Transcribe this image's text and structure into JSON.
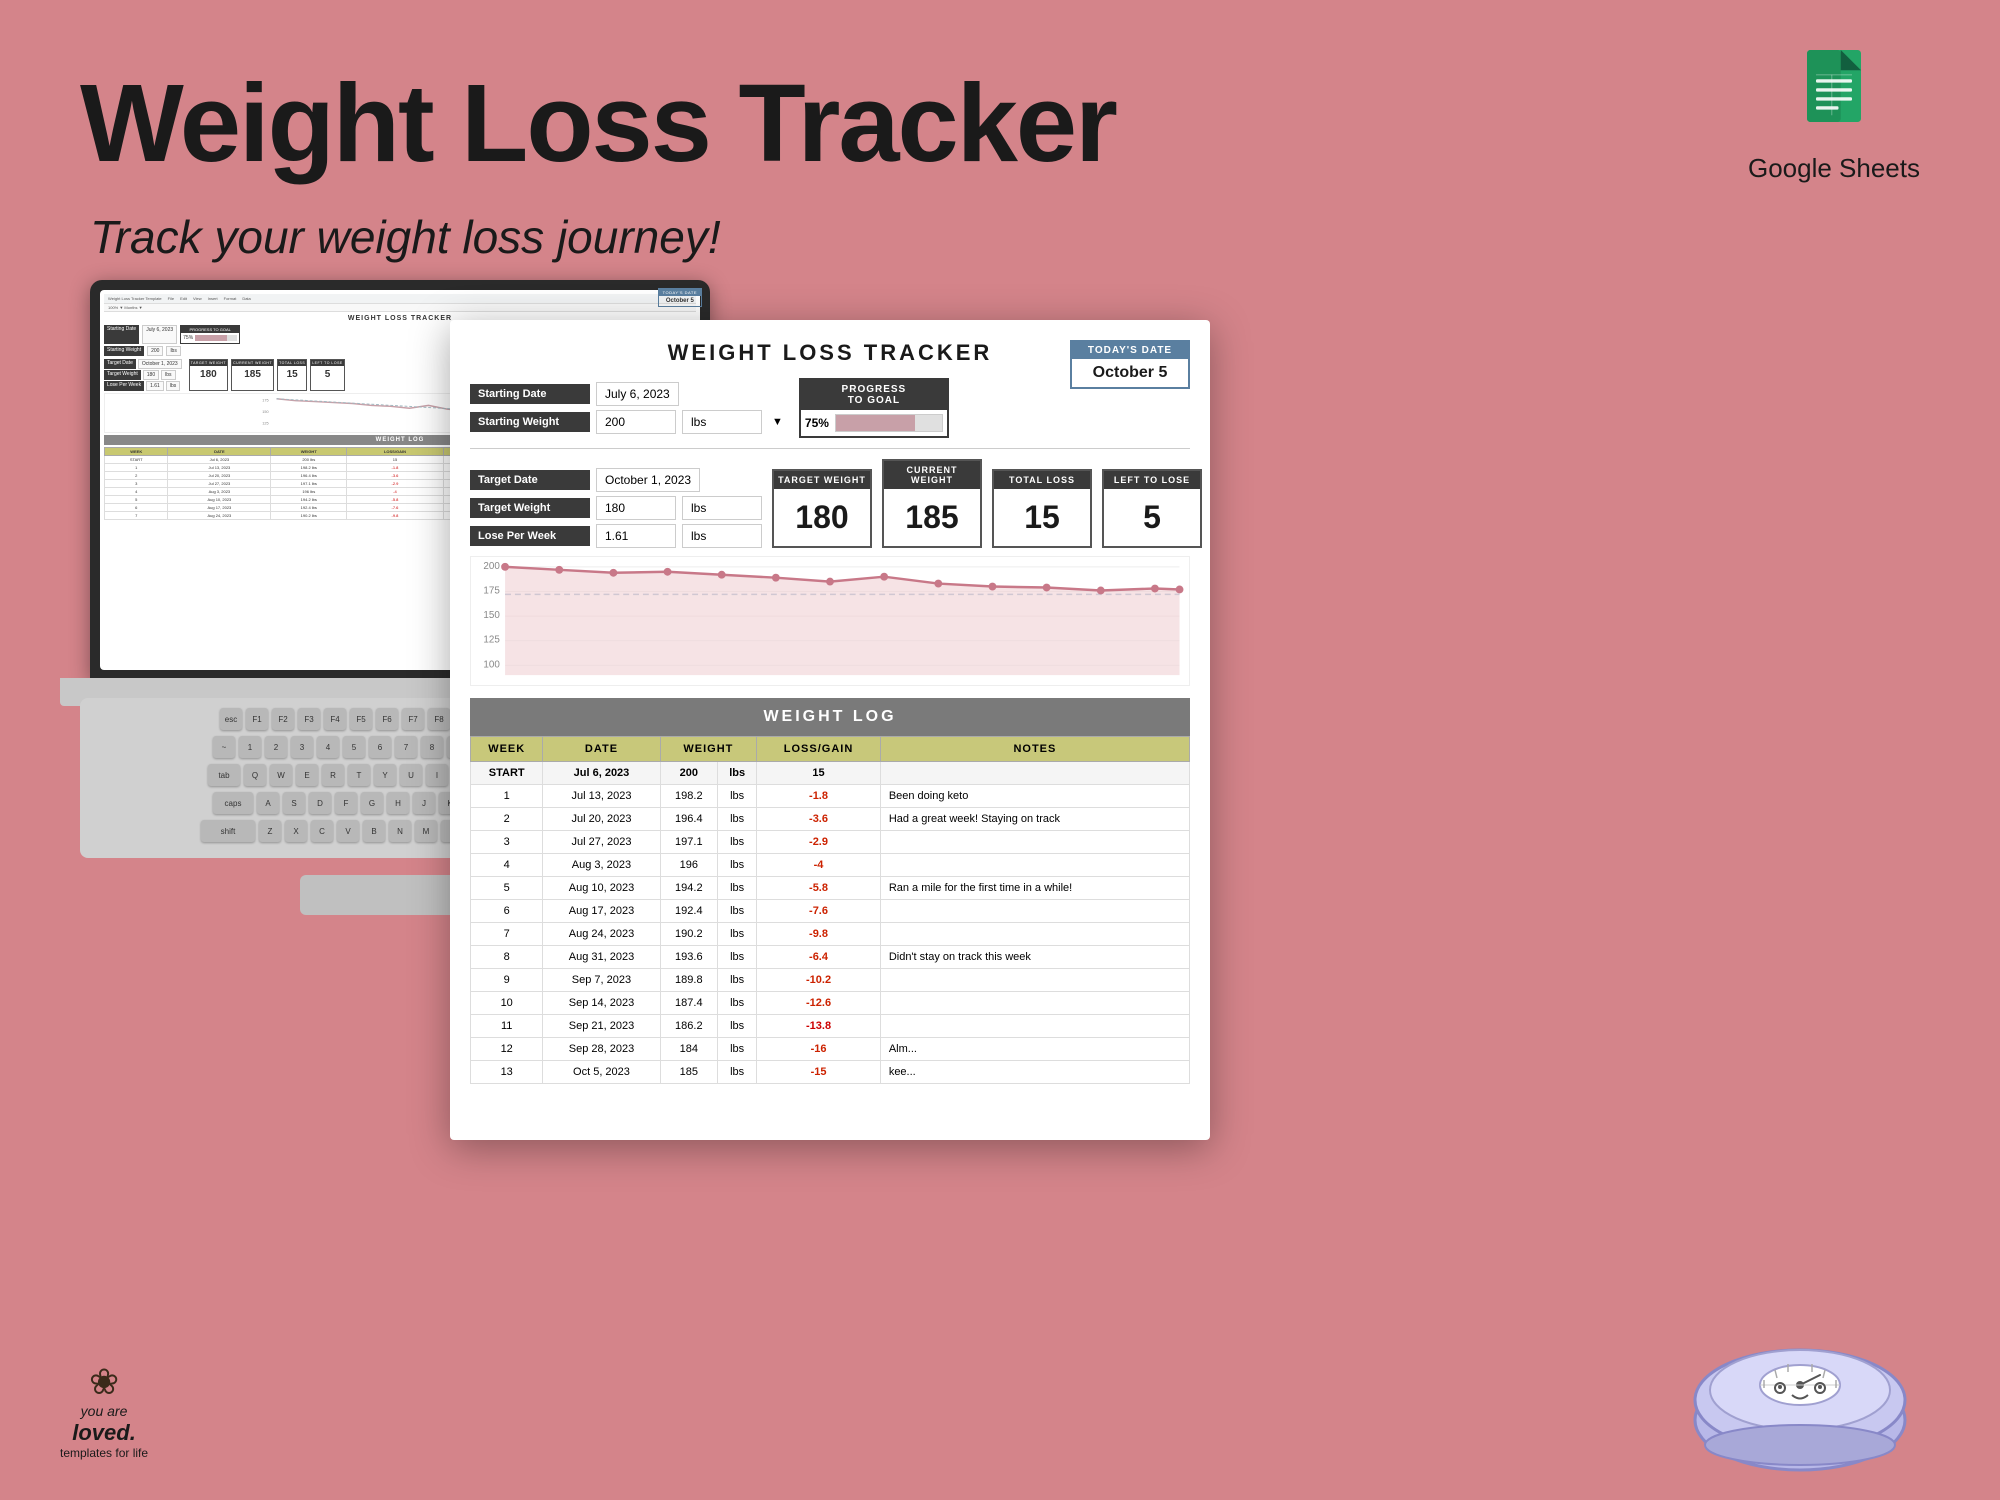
{
  "page": {
    "background_color": "#d4848a",
    "title": "Weight Loss Tracker",
    "subtitle": "Track your weight loss journey!",
    "google_sheets_label": "Google Sheets"
  },
  "header": {
    "title": "Weight Loss Tracker",
    "subtitle": "Track your weight loss journey!"
  },
  "spreadsheet": {
    "title": "WEIGHT LOSS TRACKER",
    "today_date_label": "TODAY'S DATE",
    "today_date_value": "October 5",
    "starting_date_label": "Starting Date",
    "starting_date_value": "July 6, 2023",
    "starting_weight_label": "Starting Weight",
    "starting_weight_value": "200",
    "starting_weight_unit": "lbs",
    "progress_label": "PROGRESS\nTO GOAL",
    "progress_pct": "75%",
    "target_date_label": "Target Date",
    "target_date_value": "October 1, 2023",
    "target_weight_label": "Target Weight",
    "target_weight_value": "180",
    "target_weight_unit": "lbs",
    "lose_per_week_label": "Lose Per Week",
    "lose_per_week_value": "1.61",
    "lose_per_week_unit": "lbs",
    "target_weight_stat_label": "TARGET WEIGHT",
    "target_weight_stat": "180",
    "current_weight_label": "CURRENT WEIGHT",
    "current_weight_value": "185",
    "total_loss_label": "TOTAL LOSS",
    "total_loss_value": "15",
    "left_to_lose_label": "LEFT TO LOSE",
    "left_to_lose_value": "5",
    "weight_log_title": "WEIGHT LOG",
    "chart_y_labels": [
      "200",
      "175",
      "150",
      "125",
      "100"
    ],
    "log_columns": {
      "week": "WEEK",
      "date": "DATE",
      "weight": "WEIGHT",
      "loss_gain": "LOSS/GAIN",
      "notes": "NOTES"
    },
    "log_rows": [
      {
        "week": "START",
        "date": "Jul 6, 2023",
        "weight": "200",
        "unit": "lbs",
        "loss_gain": "15",
        "note": ""
      },
      {
        "week": "1",
        "date": "Jul 13, 2023",
        "weight": "198.2",
        "unit": "lbs",
        "loss_gain": "-1.8",
        "note": "Been doing keto"
      },
      {
        "week": "2",
        "date": "Jul 20, 2023",
        "weight": "196.4",
        "unit": "lbs",
        "loss_gain": "-3.6",
        "note": "Had a great week! Staying on track"
      },
      {
        "week": "3",
        "date": "Jul 27, 2023",
        "weight": "197.1",
        "unit": "lbs",
        "loss_gain": "-2.9",
        "note": ""
      },
      {
        "week": "4",
        "date": "Aug 3, 2023",
        "weight": "196",
        "unit": "lbs",
        "loss_gain": "-4",
        "note": ""
      },
      {
        "week": "5",
        "date": "Aug 10, 2023",
        "weight": "194.2",
        "unit": "lbs",
        "loss_gain": "-5.8",
        "note": "Ran a mile for the first time in a while!"
      },
      {
        "week": "6",
        "date": "Aug 17, 2023",
        "weight": "192.4",
        "unit": "lbs",
        "loss_gain": "-7.6",
        "note": ""
      },
      {
        "week": "7",
        "date": "Aug 24, 2023",
        "weight": "190.2",
        "unit": "lbs",
        "loss_gain": "-9.8",
        "note": ""
      },
      {
        "week": "8",
        "date": "Aug 31, 2023",
        "weight": "193.6",
        "unit": "lbs",
        "loss_gain": "-6.4",
        "note": "Didn't stay on track this week"
      },
      {
        "week": "9",
        "date": "Sep 7, 2023",
        "weight": "189.8",
        "unit": "lbs",
        "loss_gain": "-10.2",
        "note": ""
      },
      {
        "week": "10",
        "date": "Sep 14, 2023",
        "weight": "187.4",
        "unit": "lbs",
        "loss_gain": "-12.6",
        "note": ""
      },
      {
        "week": "11",
        "date": "Sep 21, 2023",
        "weight": "186.2",
        "unit": "lbs",
        "loss_gain": "-13.8",
        "note": ""
      },
      {
        "week": "12",
        "date": "Sep 28, 2023",
        "weight": "184",
        "unit": "lbs",
        "loss_gain": "-16",
        "note": "Alm..."
      },
      {
        "week": "13",
        "date": "Oct 5, 2023",
        "weight": "185",
        "unit": "lbs",
        "loss_gain": "-15",
        "note": "kee..."
      }
    ]
  },
  "loved_logo": {
    "flower_icon": "❀",
    "text": "loved.",
    "subtext": "templates for life"
  }
}
